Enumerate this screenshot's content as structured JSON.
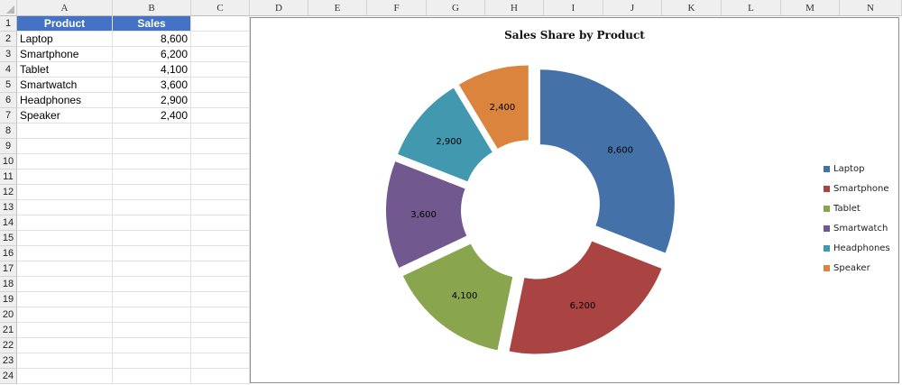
{
  "spreadsheet": {
    "columns": [
      "A",
      "B",
      "C",
      "D",
      "E",
      "F",
      "G",
      "H",
      "I",
      "J",
      "K",
      "L",
      "M",
      "N"
    ],
    "rows": [
      "1",
      "2",
      "3",
      "4",
      "5",
      "6",
      "7",
      "8",
      "9",
      "10",
      "11",
      "12",
      "13",
      "14",
      "15",
      "16",
      "17",
      "18",
      "19",
      "20",
      "21",
      "22",
      "23",
      "24"
    ],
    "table": {
      "headers": [
        "Product",
        "Sales"
      ],
      "rows": [
        [
          "Laptop",
          "8,600"
        ],
        [
          "Smartphone",
          "6,200"
        ],
        [
          "Tablet",
          "4,100"
        ],
        [
          "Smartwatch",
          "3,600"
        ],
        [
          "Headphones",
          "2,900"
        ],
        [
          "Speaker",
          "2,400"
        ]
      ]
    }
  },
  "chart_data": {
    "type": "pie",
    "variant": "exploded-donut",
    "title": "Sales Share by Product",
    "categories": [
      "Laptop",
      "Smartphone",
      "Tablet",
      "Smartwatch",
      "Headphones",
      "Speaker"
    ],
    "values": [
      8600,
      6200,
      4100,
      3600,
      2900,
      2400
    ],
    "data_labels": [
      "8,600",
      "6,200",
      "4,100",
      "3,600",
      "2,900",
      "2,400"
    ],
    "colors": [
      "#4472a8",
      "#aa4442",
      "#89a54e",
      "#71588f",
      "#4298af",
      "#db843d"
    ],
    "legend_position": "right"
  }
}
